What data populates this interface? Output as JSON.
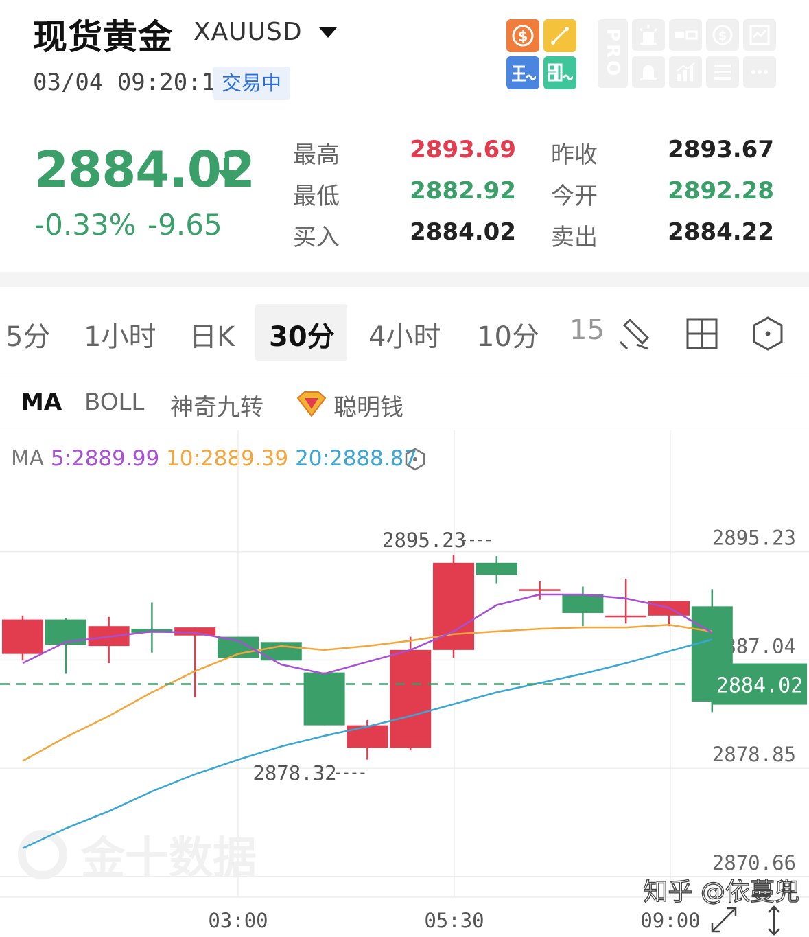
{
  "header": {
    "title": "现货黄金",
    "symbol": "XAUUSD",
    "datetime": "03/04 09:20:14",
    "status": "交易中"
  },
  "colors": {
    "up": "#e23c4f",
    "down": "#3a9f68",
    "ma5": "#a84fd6",
    "ma10": "#f2a63b",
    "ma20": "#3aa6d6"
  },
  "quote": {
    "price": "2884.02",
    "change_pct": "-0.33%",
    "change": "-9.65",
    "stats": [
      {
        "label": "最高",
        "value": "2893.69",
        "color": "red"
      },
      {
        "label": "昨收",
        "value": "2893.67",
        "color": "dark"
      },
      {
        "label": "最低",
        "value": "2882.92",
        "color": "green"
      },
      {
        "label": "今开",
        "value": "2892.28",
        "color": "green"
      },
      {
        "label": "买入",
        "value": "2884.02",
        "color": "dark"
      },
      {
        "label": "卖出",
        "value": "2884.22",
        "color": "dark"
      }
    ]
  },
  "tools": {
    "icons": [
      "dollar-icon",
      "line-tool-icon",
      "main-chart-icon",
      "sub-chart-icon",
      "pro-icon",
      "alert-icon",
      "compare-icon",
      "money-icon",
      "report-icon",
      "alarm-icon",
      "stats-icon",
      "list-icon",
      "more-icon"
    ],
    "pro_label": "PRO"
  },
  "periods": {
    "tabs": [
      "5分",
      "1小时",
      "日K",
      "30分",
      "4小时",
      "10分",
      "15"
    ],
    "active": "30分"
  },
  "indicators": {
    "tabs": [
      "MA",
      "BOLL",
      "神奇九转",
      "聪明钱"
    ],
    "active": "MA"
  },
  "ma_legend": {
    "prefix": "MA",
    "ma5": "5:2889.99",
    "ma10": "10:2889.39",
    "ma20": "20:2888.87"
  },
  "chart_data": {
    "type": "candlestick",
    "y_ticks": [
      "2895.23",
      "2887.04",
      "2878.85",
      "2870.66"
    ],
    "x_ticks": [
      "03:00",
      "05:30",
      "09:00"
    ],
    "current_price": "2884.02",
    "high_label": "2895.23",
    "low_label": "2878.32",
    "ylim": [
      2868.0,
      2897.5
    ],
    "candles": [
      {
        "o": 2886.3,
        "h": 2889.2,
        "l": 2885.8,
        "c": 2888.9
      },
      {
        "o": 2888.9,
        "h": 2889.0,
        "l": 2884.8,
        "c": 2887.0
      },
      {
        "o": 2886.9,
        "h": 2889.1,
        "l": 2885.6,
        "c": 2888.4
      },
      {
        "o": 2888.2,
        "h": 2890.2,
        "l": 2886.4,
        "c": 2887.9
      },
      {
        "o": 2887.7,
        "h": 2888.0,
        "l": 2883.0,
        "c": 2888.3
      },
      {
        "o": 2887.6,
        "h": 2886.1,
        "l": 2887.6,
        "c": 2886.0
      },
      {
        "o": 2887.2,
        "h": 2886.6,
        "l": 2886.1,
        "c": 2885.8
      },
      {
        "o": 2884.9,
        "h": 2881.6,
        "l": 2880.9,
        "c": 2880.9
      },
      {
        "o": 2879.2,
        "h": 2881.3,
        "l": 2878.3,
        "c": 2880.9
      },
      {
        "o": 2879.2,
        "h": 2887.6,
        "l": 2879.0,
        "c": 2886.6
      },
      {
        "o": 2886.6,
        "h": 2893.8,
        "l": 2886.0,
        "c": 2893.2
      },
      {
        "o": 2893.2,
        "h": 2893.7,
        "l": 2891.6,
        "c": 2892.3
      },
      {
        "o": 2891.2,
        "h": 2891.8,
        "l": 2890.4,
        "c": 2891.2
      },
      {
        "o": 2890.8,
        "h": 2891.4,
        "l": 2888.4,
        "c": 2889.4
      },
      {
        "o": 2889.2,
        "h": 2892.0,
        "l": 2888.6,
        "c": 2889.2
      },
      {
        "o": 2889.2,
        "h": 2890.2,
        "l": 2888.4,
        "c": 2890.3
      },
      {
        "o": 2889.9,
        "h": 2891.2,
        "l": 2881.9,
        "c": 2882.7
      }
    ],
    "ma5": [
      2885.6,
      2887.2,
      2887.6,
      2888.0,
      2887.9,
      2887.3,
      2885.5,
      2884.8,
      2885.7,
      2886.6,
      2888.0,
      2890.0,
      2890.8,
      2890.8,
      2890.5,
      2889.8,
      2887.9
    ],
    "ma10": [
      2878.2,
      2880.0,
      2881.6,
      2883.4,
      2885.0,
      2886.3,
      2886.9,
      2886.6,
      2886.9,
      2887.3,
      2887.8,
      2888.0,
      2888.2,
      2888.3,
      2888.3,
      2888.5,
      2888.0
    ],
    "ma20": [
      2871.6,
      2873.1,
      2874.4,
      2875.9,
      2877.2,
      2878.3,
      2879.3,
      2880.1,
      2880.8,
      2881.6,
      2882.5,
      2883.4,
      2884.1,
      2884.8,
      2885.6,
      2886.5,
      2887.4
    ],
    "watermark": "金十数据",
    "credit": "知乎 @依蔓兜"
  }
}
